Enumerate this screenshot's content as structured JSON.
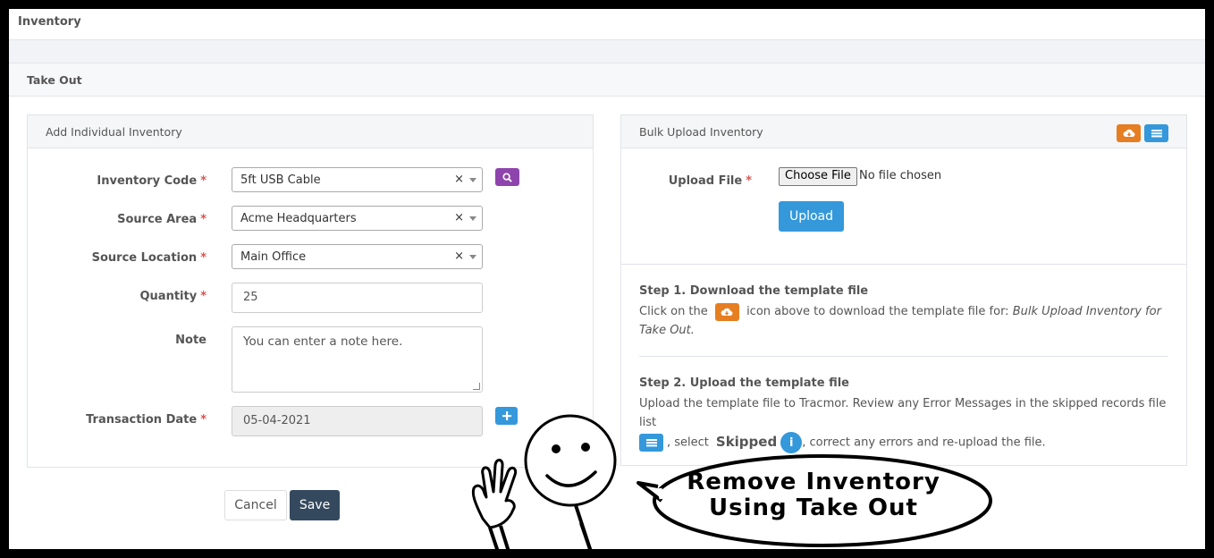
{
  "header": {
    "title": "Inventory"
  },
  "section": {
    "title": "Take Out"
  },
  "left_panel": {
    "title": "Add Individual Inventory",
    "fields": {
      "inventory_code": {
        "label": "Inventory Code",
        "value": "5ft USB Cable"
      },
      "source_area": {
        "label": "Source Area",
        "value": "Acme Headquarters"
      },
      "source_location": {
        "label": "Source Location",
        "value": "Main Office"
      },
      "quantity": {
        "label": "Quantity",
        "value": "25"
      },
      "note": {
        "label": "Note",
        "placeholder": "You can enter a note here."
      },
      "transaction_date": {
        "label": "Transaction Date",
        "value": "05-04-2021"
      }
    },
    "required_mark": "*",
    "clear_symbol": "×",
    "cancel_label": "Cancel",
    "save_label": "Save"
  },
  "right_panel": {
    "title": "Bulk Upload Inventory",
    "upload_label": "Upload File",
    "choose_file_label": "Choose File",
    "no_file_text": "No file chosen",
    "upload_button": "Upload",
    "step1": {
      "title": "Step 1. Download the template file",
      "text_before": "Click on the",
      "text_after": "icon above to download the template file for:",
      "template_name": "Bulk Upload Inventory for Take Out."
    },
    "step2": {
      "title": "Step 2. Upload the template file",
      "text_line1": "Upload the template file to Tracmor. Review any Error Messages in the skipped records file list",
      "text_select": ", select",
      "skipped_label": "Skipped",
      "info_symbol": "i",
      "text_end": ", correct any errors and re-upload the file."
    }
  },
  "overlay": {
    "bubble_line1": "Remove Inventory",
    "bubble_line2": "Using Take Out"
  },
  "colors": {
    "purple": "#8e44ad",
    "blue": "#3498db",
    "orange": "#e67e22",
    "dark": "#34495e",
    "required": "#d9534f"
  }
}
